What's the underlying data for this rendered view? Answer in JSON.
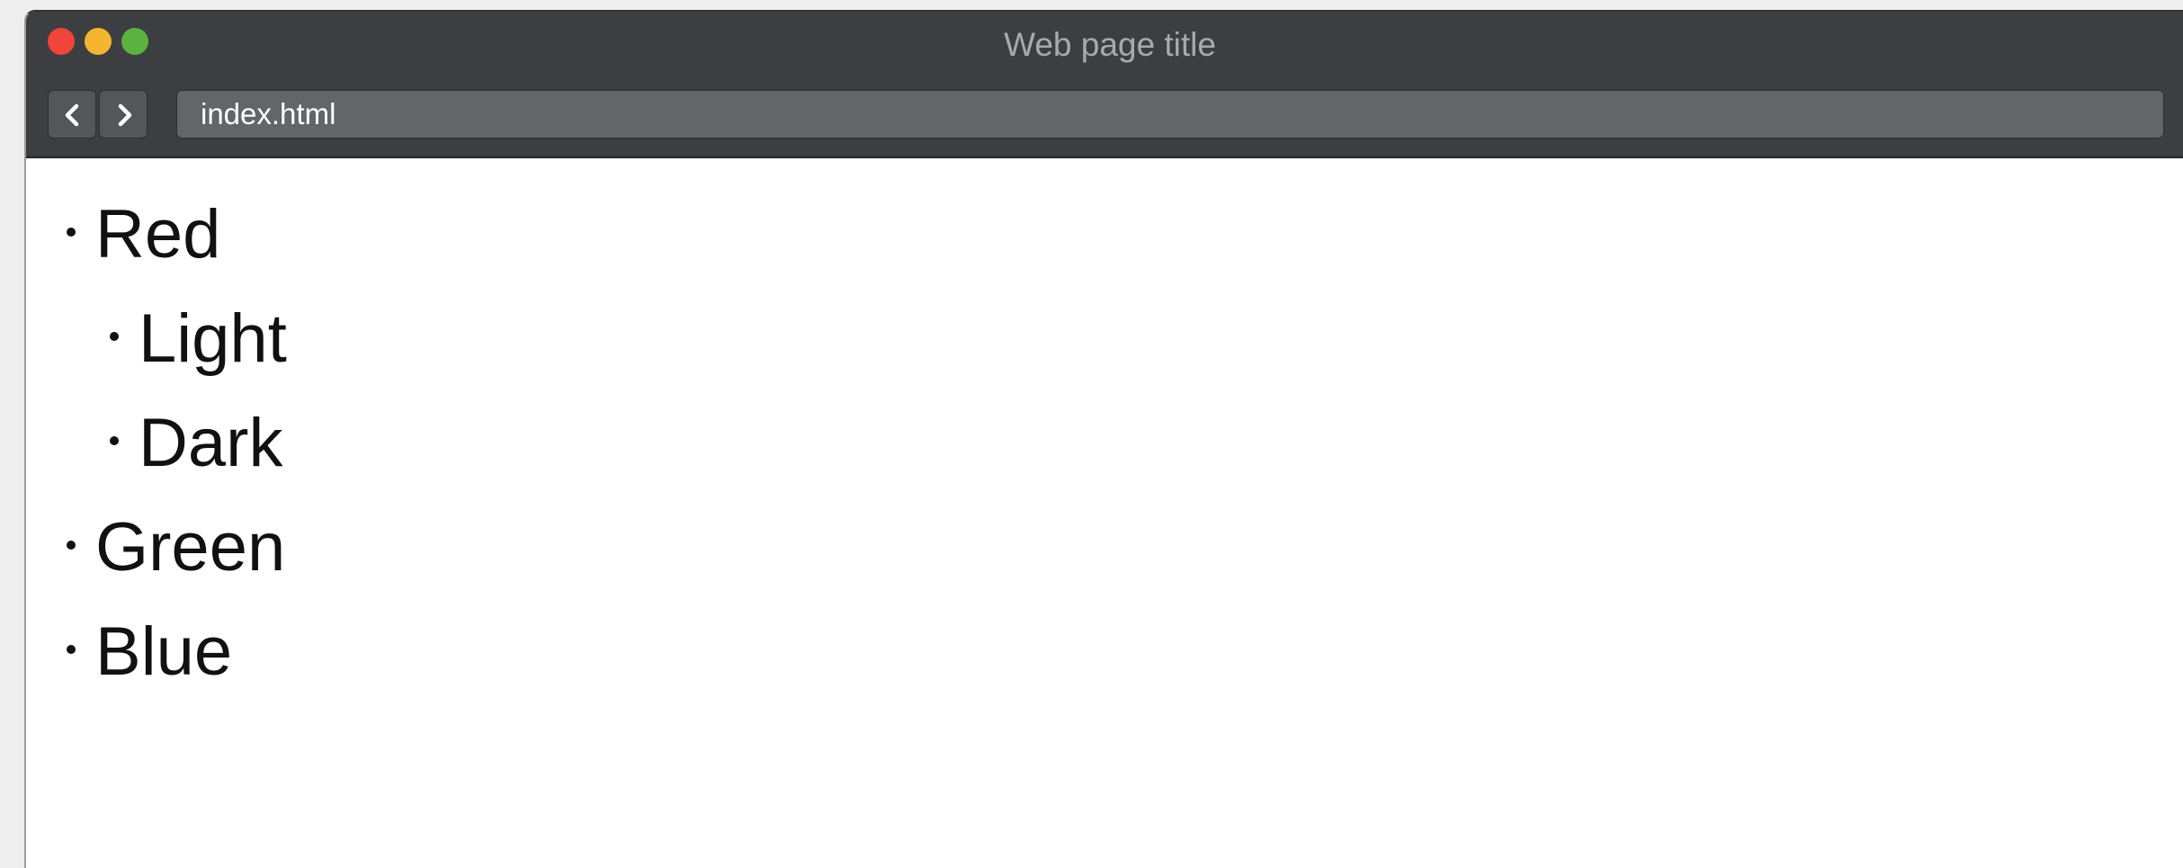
{
  "window": {
    "title": "Web page title",
    "controls": {
      "close_color": "#f1443a",
      "minimize_color": "#f6b52e",
      "zoom_color": "#5ab33e"
    }
  },
  "toolbar": {
    "back_icon": "chevron-left-icon",
    "forward_icon": "chevron-right-icon",
    "address": "index.html"
  },
  "page": {
    "list": [
      {
        "label": "Red",
        "level": 1
      },
      {
        "label": "Light",
        "level": 2
      },
      {
        "label": "Dark",
        "level": 2
      },
      {
        "label": "Green",
        "level": 1
      },
      {
        "label": "Blue",
        "level": 1
      }
    ]
  }
}
